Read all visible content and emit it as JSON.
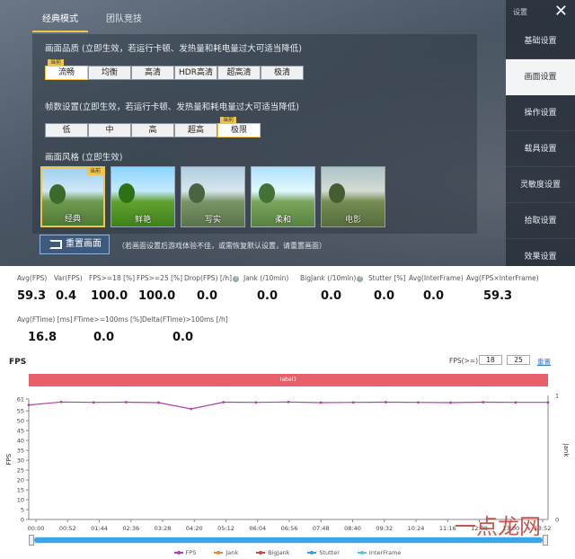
{
  "game": {
    "tabs": [
      "经典模式",
      "团队竞技"
    ],
    "quality_hint": "画面品质 (立即生效，若运行卡顿、发热量和耗电量过大可适当降低)",
    "quality_options": [
      "流畅",
      "均衡",
      "高清",
      "HDR高清",
      "超高清",
      "极清"
    ],
    "quality_selected_index": 0,
    "current_tag": "当前",
    "fps_hint": "帧数设置(立即生效，若运行卡顿、发热量和耗电量过大可适当降低)",
    "fps_options": [
      "低",
      "中",
      "高",
      "超高",
      "极限"
    ],
    "fps_selected_index": 4,
    "style_hint": "画面风格 (立即生效)",
    "styles": [
      "经典",
      "鲜艳",
      "写实",
      "柔和",
      "电影"
    ],
    "style_selected_index": 0,
    "reset_label": "重置画面",
    "reset_note": "（若画面设置后游戏体验不佳，或需恢复默认设置，请重置画面）",
    "side_title": "设置",
    "side_items": [
      "基础设置",
      "画面设置",
      "操作设置",
      "载具设置",
      "灵敏度设置",
      "拾取设置",
      "效果设置"
    ],
    "side_selected_index": 1
  },
  "metrics_row1": [
    {
      "label": "Avg(FPS)",
      "value": "59.3"
    },
    {
      "label": "Var(FPS)",
      "value": "0.4"
    },
    {
      "label": "FPS>=18 [%]",
      "value": "100.0"
    },
    {
      "label": "FPS>=25 [%]",
      "value": "100.0"
    },
    {
      "label": "Drop(FPS) [/h]",
      "value": "0.0"
    },
    {
      "label": "Jank (/10min)",
      "value": "0.0"
    },
    {
      "label": "BigJank (/10min)",
      "value": "0.0"
    },
    {
      "label": "Stutter [%]",
      "value": "0.0"
    },
    {
      "label": "Avg(InterFrame)",
      "value": "0.0"
    },
    {
      "label": "Avg(FPS×InterFrame)",
      "value": "59.3"
    }
  ],
  "metrics_row2": [
    {
      "label": "Avg(FTime) [ms]",
      "value": "16.8"
    },
    {
      "label": "FTime>=100ms [%]",
      "value": "0.0"
    },
    {
      "label": "Delta(FTime)>100ms [/h]",
      "value": "0.0"
    }
  ],
  "fps_panel": {
    "title": "FPS",
    "filter_label": "FPS(>=)",
    "filter_values": [
      "18",
      "25"
    ],
    "reset_link": "重置",
    "label_bar": "label1"
  },
  "chart_data": {
    "type": "line",
    "ylabel": "FPS",
    "y2label": "Jank",
    "yticks": [
      0,
      5,
      10,
      15,
      20,
      25,
      30,
      35,
      40,
      45,
      50,
      55,
      61
    ],
    "y2ticks": [
      0,
      1
    ],
    "ylim": [
      0,
      61
    ],
    "xticks": [
      "00:00",
      "00:52",
      "01:44",
      "02:36",
      "03:28",
      "04:20",
      "05:12",
      "06:04",
      "06:56",
      "07:48",
      "08:40",
      "09:32",
      "10:24",
      "11:16",
      "12:08",
      "13:00",
      "13:52"
    ],
    "series": [
      {
        "name": "FPS",
        "color": "#b040b0",
        "values": [
          58,
          59.5,
          59.3,
          59.4,
          59.2,
          56,
          59.4,
          59.3,
          59.5,
          59.2,
          59.3,
          59.4,
          59.3,
          59.2,
          59.4,
          59.3,
          59.3
        ]
      },
      {
        "name": "Jank",
        "color": "#e8863a",
        "values": []
      },
      {
        "name": "BigJank",
        "color": "#d0443c",
        "values": []
      },
      {
        "name": "Stutter",
        "color": "#3a9be0",
        "values": []
      },
      {
        "name": "InterFrame",
        "color": "#5bc0de",
        "values": []
      }
    ]
  },
  "watermark": "一点龙网"
}
